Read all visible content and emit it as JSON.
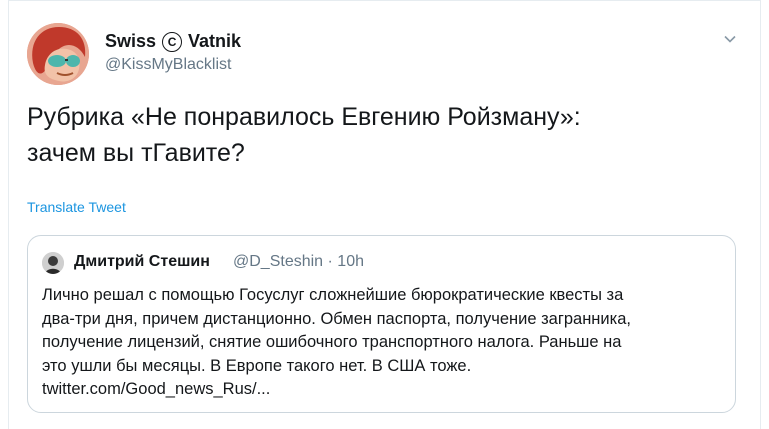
{
  "author": {
    "name_part1": "Swiss",
    "copyright_symbol": "C",
    "name_part2": "Vatnik",
    "handle": "@KissMyBlacklist"
  },
  "tweet_text": "Рубрика «Не понравилось Евгению Ройзману»:\nзачем вы тГавите?",
  "translate_label": "Translate Tweet",
  "quoted": {
    "name": "Дмитрий Стешин",
    "handle": "@D_Steshin",
    "separator": "·",
    "time": "10h",
    "text": "Лично решал с помощью Госуслуг сложнейшие бюрократические квесты за\nдва-три дня, причем дистанционно. Обмен паспорта, получение загранника,\nполучение лицензий, снятие ошибочного транспортного налога. Раньше на\nэто ушли бы месяцы. В Европе такого нет. В США тоже.\ntwitter.com/Good_news_Rus/..."
  },
  "icons": {
    "caret": "chevron-down-icon",
    "copyright": "copyright-icon"
  },
  "colors": {
    "text": "#14171a",
    "secondary": "#657786",
    "link": "#1b95e0",
    "border": "#ccd6dd"
  }
}
